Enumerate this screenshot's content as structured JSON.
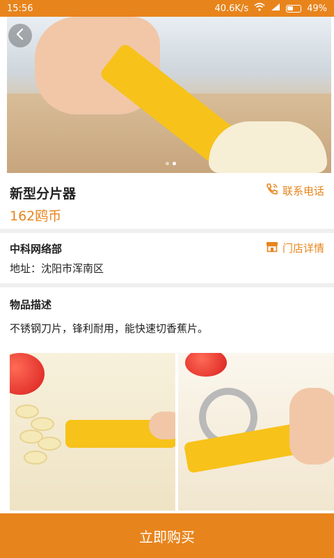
{
  "status_bar": {
    "time": "15:56",
    "network_speed": "40.6K/s",
    "battery": "49%"
  },
  "product": {
    "title": "新型分片器",
    "price": "162鸥币",
    "contact_label": "联系电话"
  },
  "store": {
    "name": "中科网络部",
    "address": "地址：沈阳市浑南区",
    "detail_label": "门店详情"
  },
  "description": {
    "section_title": "物品描述",
    "text": "不锈钢刀片，锋利耐用，能快速切香蕉片。"
  },
  "carousel": {
    "count": 2,
    "active_index": 1
  },
  "buy_button": {
    "label": "立即购买"
  },
  "colors": {
    "accent": "#e8841c"
  }
}
